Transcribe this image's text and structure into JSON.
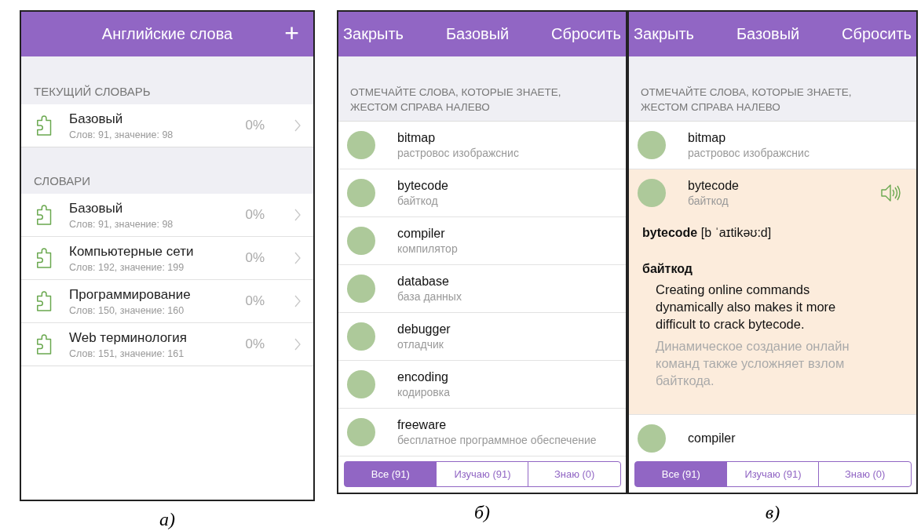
{
  "panel_a": {
    "header": {
      "title": "Английские слова",
      "add_button": "+"
    },
    "sections": [
      {
        "title": "ТЕКУЩИЙ СЛОВАРЬ",
        "items": [
          {
            "name": "Базовый",
            "meta": "Слов: 91, значение: 98",
            "percent": "0%"
          }
        ]
      },
      {
        "title": "СЛОВАРИ",
        "items": [
          {
            "name": "Базовый",
            "meta": "Слов: 91, значение: 98",
            "percent": "0%"
          },
          {
            "name": "Компьютерные сети",
            "meta": "Слов: 192, значение: 199",
            "percent": "0%"
          },
          {
            "name": "Программирование",
            "meta": "Слов: 150, значение: 160",
            "percent": "0%"
          },
          {
            "name": "Web терминология",
            "meta": "Слов: 151, значение: 161",
            "percent": "0%"
          }
        ]
      }
    ],
    "caption": "а)"
  },
  "panel_b": {
    "toolbar": [
      "Закрыть",
      "Базовый",
      "Сбросить"
    ],
    "hint": "ОТМЕЧАЙТЕ СЛОВА, КОТОРЫЕ ЗНАЕТЕ, ЖЕСТОМ СПРАВА НАЛЕВО",
    "words": [
      {
        "word": "bitmap",
        "translation": "растровос изображснис",
        "expanded": false
      },
      {
        "word": "bytecode",
        "translation": "байткод",
        "expanded": false
      },
      {
        "word": "compiler",
        "translation": "компилятор",
        "expanded": false
      },
      {
        "word": "database",
        "translation": "база данных",
        "expanded": false
      },
      {
        "word": "debugger",
        "translation": "отладчик",
        "expanded": false
      },
      {
        "word": "encoding",
        "translation": "кодировка",
        "expanded": false
      },
      {
        "word": "freeware",
        "translation": "бесплатное программное обеспечение",
        "expanded": false
      }
    ],
    "filters": [
      {
        "label": "Все (91)",
        "selected": true
      },
      {
        "label": "Изучаю (91)",
        "selected": false
      },
      {
        "label": "Знаю (0)",
        "selected": false
      }
    ],
    "caption": "б)"
  },
  "panel_c": {
    "toolbar": [
      "Закрыть",
      "Базовый",
      "Сбросить"
    ],
    "hint": "ОТМЕЧАЙТЕ СЛОВА, КОТОРЫЕ ЗНАЕТЕ, ЖЕСТОМ СПРАВА НАЛЕВО",
    "words": [
      {
        "word": "bitmap",
        "translation": "растровос изображснис",
        "expanded": false
      },
      {
        "word": "bytecode",
        "translation": "байткод",
        "expanded": true,
        "details": {
          "pronunciation": "**bytecode** [b ˈaɪtikəʊ:d]",
          "meaning": "байткод",
          "example": "Creating online commands dynamically also makes it more difficult to crack bytecode.",
          "example_translation": "Динамическое создание онлайн команд также усложняет взлом байткода."
        }
      },
      {
        "word": "compiler",
        "expanded": false
      }
    ],
    "filters": [
      {
        "label": "Все (91)",
        "selected": true
      },
      {
        "label": "Изучаю (91)",
        "selected": false
      },
      {
        "label": "Знаю (0)",
        "selected": false
      }
    ],
    "caption": "в)"
  }
}
